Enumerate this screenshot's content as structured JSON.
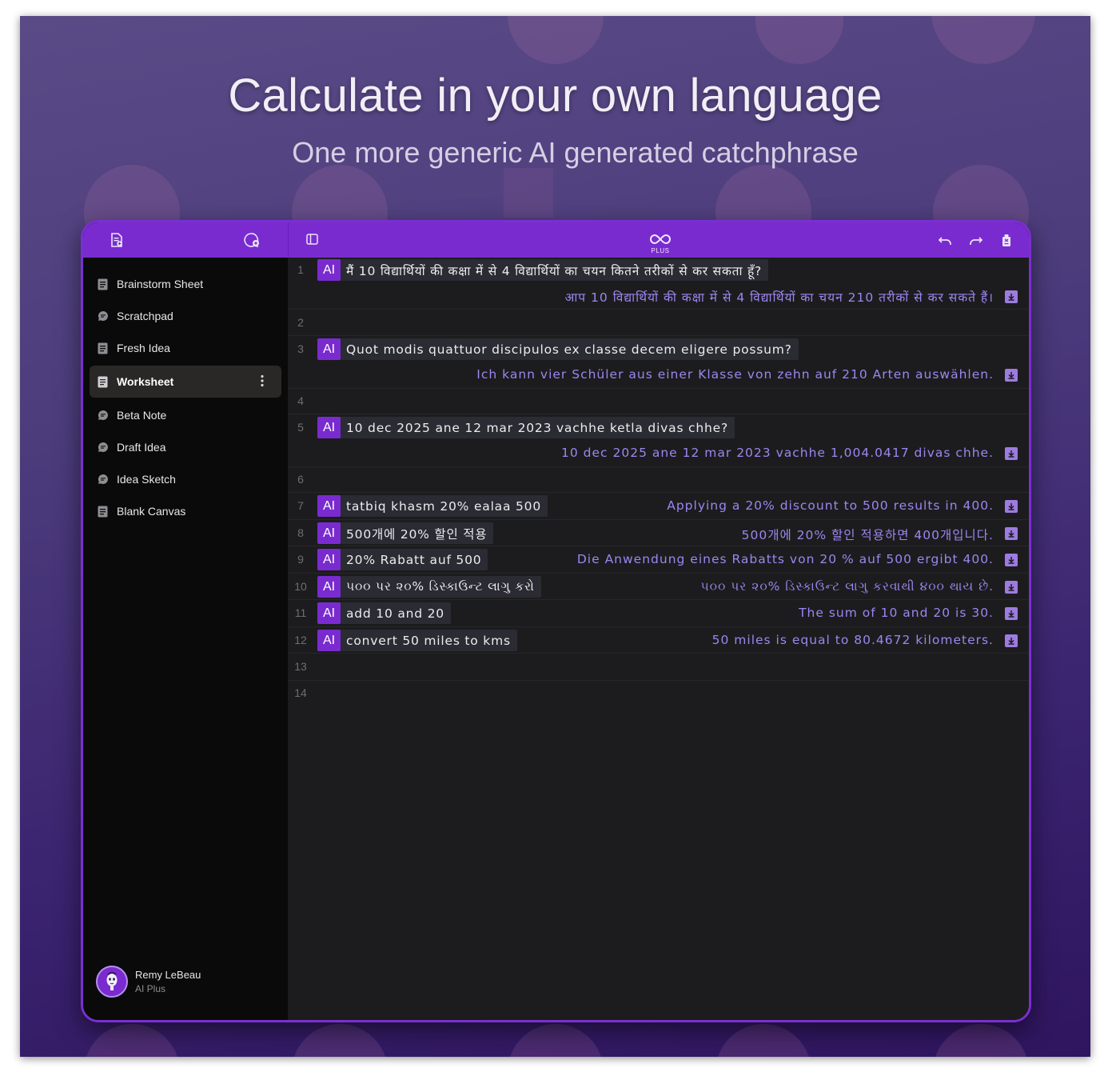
{
  "hero": {
    "headline": "Calculate in your own language",
    "subline": "One more generic AI generated catchphrase"
  },
  "colors": {
    "accent": "#7a2bd0",
    "answer": "#9d86f0",
    "sidebar": "#0a0a0a",
    "editor": "#1c1c1e"
  },
  "sidebar": {
    "new_sheet_icon": "new-sheet-icon",
    "new_chat_icon": "new-chat-icon",
    "items": [
      {
        "label": "Brainstorm Sheet",
        "icon": "sheet-icon"
      },
      {
        "label": "Scratchpad",
        "icon": "chat-icon"
      },
      {
        "label": "Fresh Idea",
        "icon": "sheet-icon"
      },
      {
        "label": "Worksheet",
        "icon": "sheet-icon",
        "active": true
      },
      {
        "label": "Beta Note",
        "icon": "chat-icon"
      },
      {
        "label": "Draft Idea",
        "icon": "chat-icon"
      },
      {
        "label": "Idea Sketch",
        "icon": "chat-icon"
      },
      {
        "label": "Blank Canvas",
        "icon": "sheet-icon"
      }
    ],
    "user": {
      "name": "Remy LeBeau",
      "plan": "AI Plus"
    }
  },
  "toolbar": {
    "logo_badge": "PLUS"
  },
  "editor": {
    "ai_tag": "AI",
    "lines": [
      {
        "n": "1",
        "q": "मैं 10 विद्यार्थियों की कक्षा में से 4 विद्यार्थियों का चयन कितने तरीकों से कर सकता हूँ?",
        "a": "आप 10 विद्यार्थियों की कक्षा में से 4 विद्यार्थियों का चयन 210 तरीकों से कर सकते हैं।"
      },
      {
        "n": "2"
      },
      {
        "n": "3",
        "q": "Quot modis quattuor discipulos ex classe decem eligere possum?",
        "a": "Ich kann vier Schüler aus einer Klasse von zehn auf 210 Arten auswählen."
      },
      {
        "n": "4"
      },
      {
        "n": "5",
        "q": "10 dec 2025 ane 12 mar 2023 vachhe ketla divas chhe?",
        "a": "10 dec 2025 ane 12 mar 2023 vachhe 1,004.0417 divas chhe."
      },
      {
        "n": "6"
      },
      {
        "n": "7",
        "q": "tatbiq khasm 20% ealaa 500",
        "a": "Applying a 20% discount to 500 results in 400.",
        "inline": true
      },
      {
        "n": "8",
        "q": "500개에 20% 할인 적용",
        "a": "500개에 20% 할인 적용하면 400개입니다.",
        "inline": true
      },
      {
        "n": "9",
        "q": "20% Rabatt auf 500",
        "a": "Die Anwendung eines Rabatts von 20 % auf 500 ergibt 400.",
        "inline": true
      },
      {
        "n": "10",
        "q": "૫૦૦ પર ૨૦% ડિસ્કાઉન્ટ લાગુ કરો",
        "a": "૫૦૦ પર ૨૦% ડિસ્કાઉન્ટ લાગુ કરવાથી ૪૦૦ થાય છે.",
        "inline": true
      },
      {
        "n": "11",
        "q": "add 10 and 20",
        "a": "The sum of 10 and 20 is 30.",
        "inline": true
      },
      {
        "n": "12",
        "q": "convert 50 miles to kms",
        "a": "50 miles is equal to 80.4672 kilometers.",
        "inline": true
      },
      {
        "n": "13"
      },
      {
        "n": "14"
      }
    ]
  }
}
